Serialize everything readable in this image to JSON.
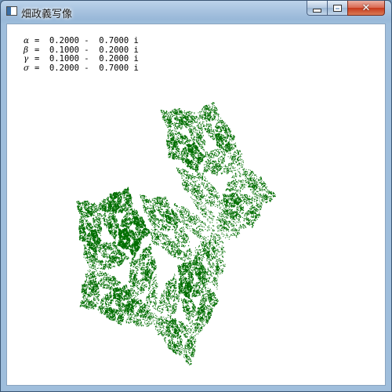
{
  "window": {
    "title": "畑政義写像",
    "icon": "app-window-icon",
    "controls": {
      "minimize": "minimize-icon",
      "maximize": "maximize-icon",
      "close": "close-icon"
    }
  },
  "parameters": [
    {
      "symbol": "α",
      "eq": "=",
      "re": "0.2000",
      "op": "-",
      "im": "0.7000",
      "unit": "i"
    },
    {
      "symbol": "β",
      "eq": "=",
      "re": "0.1000",
      "op": "-",
      "im": "0.2000",
      "unit": "i"
    },
    {
      "symbol": "γ",
      "eq": "=",
      "re": "0.1000",
      "op": "-",
      "im": "0.2000",
      "unit": "i"
    },
    {
      "symbol": "σ",
      "eq": "=",
      "re": "0.2000",
      "op": "-",
      "im": "0.7000",
      "unit": "i"
    }
  ],
  "fractal": {
    "color": "#006e00"
  },
  "colors": {
    "titlebar": "#a9c4e0",
    "close_button": "#c7391b",
    "client_background": "#ffffff",
    "text": "#000000"
  }
}
